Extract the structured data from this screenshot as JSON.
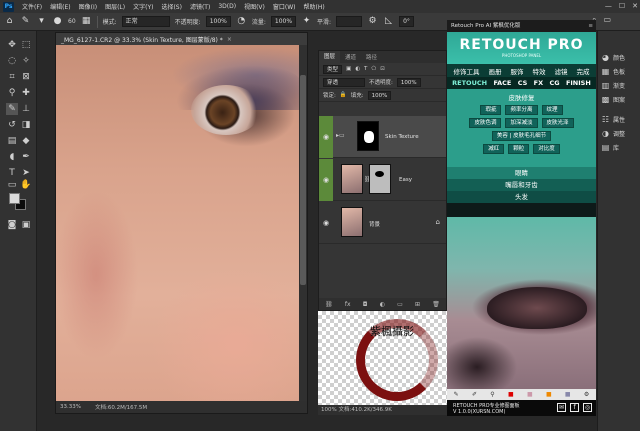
{
  "menubar": {
    "logo": "Ps",
    "items": [
      "文件(F)",
      "编辑(E)",
      "图像(I)",
      "图层(L)",
      "文字(Y)",
      "选择(S)",
      "滤镜(T)",
      "3D(D)",
      "视图(V)",
      "窗口(W)",
      "帮助(H)"
    ],
    "window_controls": [
      "—",
      "☐",
      "✕"
    ]
  },
  "options": {
    "mode_label": "模式:",
    "mode_value": "正常",
    "opacity_label": "不透明度:",
    "opacity_value": "100%",
    "flow_label": "流量:",
    "flow_value": "100%",
    "smooth_label": "平滑:",
    "angle_value": "0°",
    "brush_size": "60"
  },
  "document": {
    "tab_title": "_MG_6127-1.CR2 @ 33.3% (Skin Texture, 图层蒙版/8) *",
    "close": "×",
    "zoom": "33.33%",
    "doc_info": "文档:60.2M/167.5M"
  },
  "layers_panel": {
    "tabs": [
      "图层",
      "通道",
      "路径"
    ],
    "active_tab": "图层",
    "filter_label": "类型",
    "blend_mode": "穿透",
    "opacity_label": "不透明度:",
    "opacity_value": "100%",
    "lock_label": "锁定:",
    "fill_label": "填充:",
    "fill_value": "100%",
    "layers": [
      {
        "name": "Skin Texture",
        "kind": "group"
      },
      {
        "name": "Easy",
        "kind": "adjustment"
      },
      {
        "name": "背景",
        "kind": "background"
      }
    ],
    "footer_icons": [
      "link-icon",
      "fx-icon",
      "mask-icon",
      "adjust-icon",
      "folder-icon",
      "new-layer-icon",
      "trash-icon"
    ],
    "footer_labels": [
      "⛓",
      "fx",
      "◘",
      "◐",
      "▭",
      "⊞",
      "🗑"
    ]
  },
  "doc2": {
    "watermark": "紫楓攝影",
    "info": "100%  文档:410.2K/346.9K"
  },
  "retouch_pro": {
    "panel_title": "Retouch Pro AI 紫枫优化版",
    "logo": "RETOUCH PRO",
    "logo_sub": "PHOTOSHOP PANEL",
    "cn_tabs": [
      "修饰工具",
      "画册",
      "服饰",
      "特效",
      "滤镜",
      "完成"
    ],
    "en_tabs": [
      "RETOUCH",
      "FACE",
      "CS",
      "FX",
      "CG",
      "FINISH"
    ],
    "active_en_tab": "RETOUCH",
    "skin_title": "皮肤修复",
    "skin_buttons_row1": [
      "瑕疵",
      "频率分离",
      "纹理"
    ],
    "skin_buttons_row2": [
      "皮肤色调",
      "加深减淡",
      "皮肤光泽"
    ],
    "skin_buttons_row3": [
      "美容 | 皮肤毛孔细节"
    ],
    "skin_buttons_row4": [
      "减红",
      "颗粒",
      "对比度"
    ],
    "strips": [
      "眼睛",
      "嘴唇和牙齿",
      "头发"
    ],
    "footer_line1": "RETOUCH PRO专业修图面板",
    "footer_line2": "V 1.0.0(XURSN.COM)",
    "social": [
      "f",
      "◎",
      "✉"
    ]
  },
  "dock": {
    "items": [
      "颜色",
      "色板",
      "渐变",
      "图案",
      "属性",
      "调整",
      "库"
    ]
  }
}
